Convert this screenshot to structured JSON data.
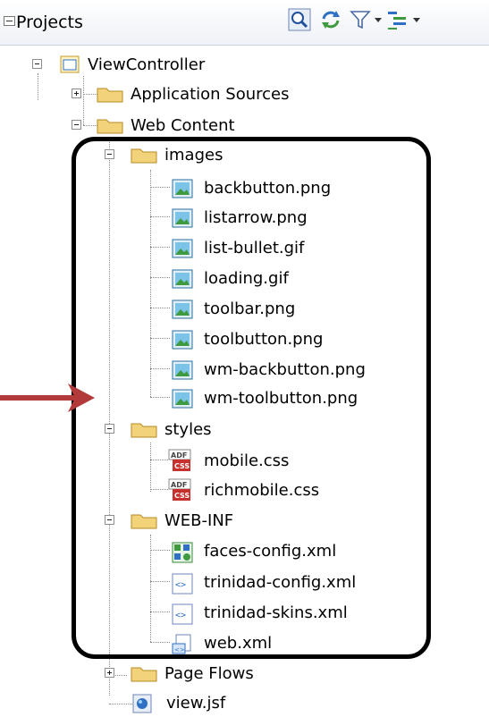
{
  "panel": {
    "title": "Projects"
  },
  "toolbar": [
    {
      "icon": "search-icon"
    },
    {
      "icon": "sync-icon"
    },
    {
      "icon": "filter-icon"
    },
    {
      "icon": "tree-options-icon"
    }
  ],
  "tree": {
    "root": "ViewController",
    "application_sources": "Application Sources",
    "web_content": "Web Content",
    "images_folder": "images",
    "images": [
      "backbutton.png",
      "listarrow.png",
      "list-bullet.gif",
      "loading.gif",
      "toolbar.png",
      "toolbutton.png",
      "wm-backbutton.png",
      "wm-toolbutton.png"
    ],
    "styles_folder": "styles",
    "styles": [
      "mobile.css",
      "richmobile.css"
    ],
    "webinf_folder": "WEB-INF",
    "webinf": [
      "faces-config.xml",
      "trinidad-config.xml",
      "trinidad-skins.xml",
      "web.xml"
    ],
    "page_flows": "Page Flows",
    "view_jsf": "view.jsf"
  },
  "colors": {
    "arrow": "#b23a3a",
    "folder": "#f2d37a",
    "highlight": "#000000"
  }
}
